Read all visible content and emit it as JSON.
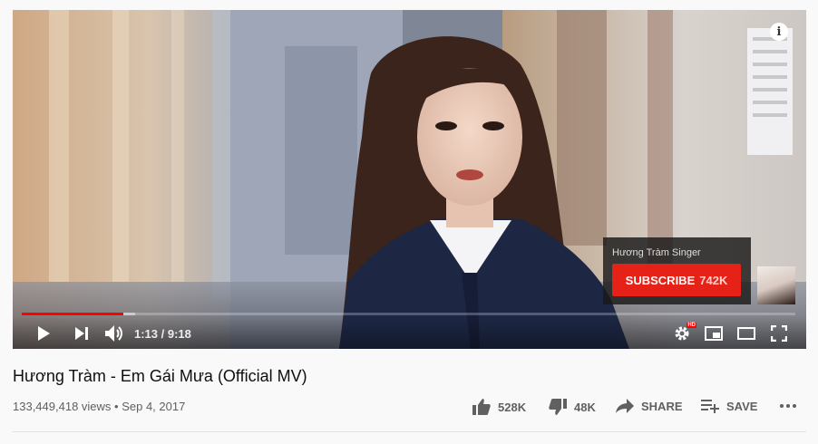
{
  "player": {
    "info_label": "i",
    "subscribe_card": {
      "channel_name": "Hương Tràm Singer",
      "subscribe_label": "SUBSCRIBE",
      "subscriber_count": "742K"
    },
    "progress": {
      "played_fraction": 0.131,
      "loaded_fraction": 0.146
    },
    "controls": {
      "current_time": "1:13",
      "time_separator": " / ",
      "duration": "9:18",
      "settings_badge": "HD",
      "icons": [
        "play-icon",
        "next-icon",
        "volume-icon",
        "settings-icon",
        "miniplayer-icon",
        "theater-icon",
        "fullscreen-icon"
      ]
    },
    "accent_color": "#ff0000",
    "subscribe_color": "#e62117"
  },
  "video": {
    "title": "Hương Tràm - Em Gái Mưa (Official MV)",
    "views": "133,449,418 views",
    "dot": " • ",
    "date": "Sep 4, 2017"
  },
  "actions": {
    "like_count": "528K",
    "dislike_count": "48K",
    "share_label": "SHARE",
    "save_label": "SAVE",
    "icons": [
      "thumb-up-icon",
      "thumb-down-icon",
      "share-icon",
      "playlist-add-icon",
      "more-icon"
    ]
  }
}
